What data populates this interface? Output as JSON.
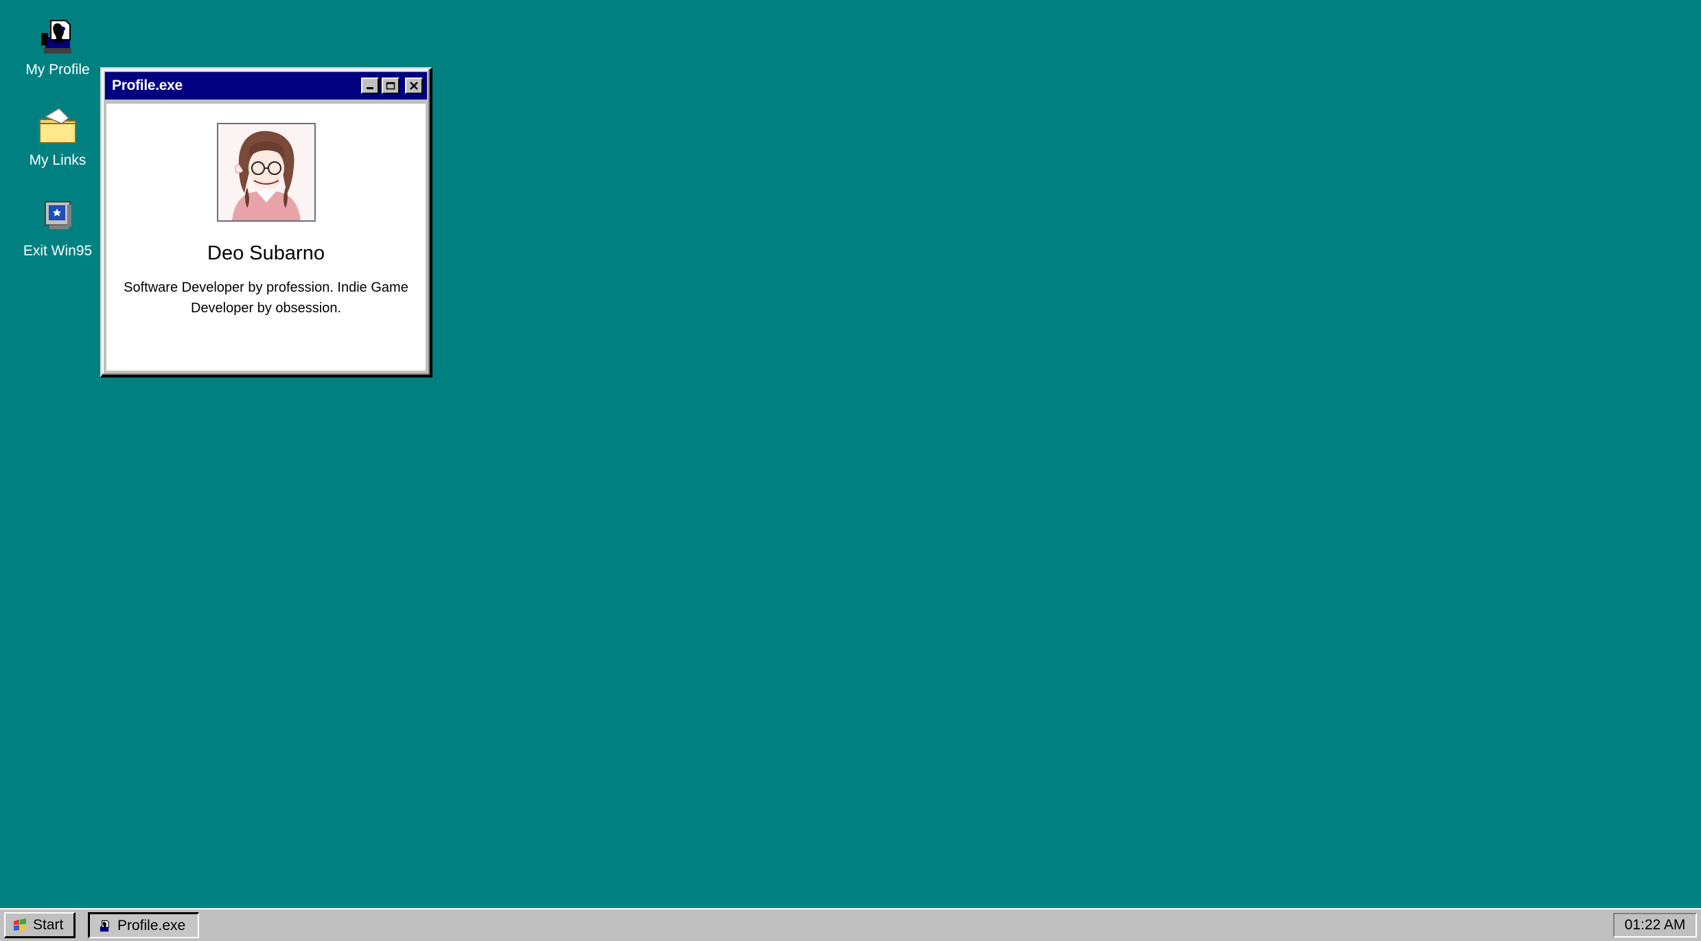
{
  "desktop": {
    "background": "#008080",
    "icons": [
      {
        "label": "My Profile",
        "icon": "profile-icon"
      },
      {
        "label": "My Links",
        "icon": "folder-icon"
      },
      {
        "label": "Exit Win95",
        "icon": "computer-exit-icon"
      }
    ]
  },
  "window": {
    "title": "Profile.exe",
    "controls": [
      "minimize",
      "maximize",
      "close"
    ],
    "avatar_icon": "avatar-illustration",
    "name": "Deo Subarno",
    "bio": "Software Developer by profession. Indie Game Developer by obsession."
  },
  "taskbar": {
    "start_label": "Start",
    "tasks": [
      {
        "label": "Profile.exe",
        "active": true
      }
    ],
    "clock": "01:22 AM"
  },
  "colors": {
    "desktop": "#008080",
    "titlebar": "#000080",
    "chrome": "#c0c0c0"
  }
}
